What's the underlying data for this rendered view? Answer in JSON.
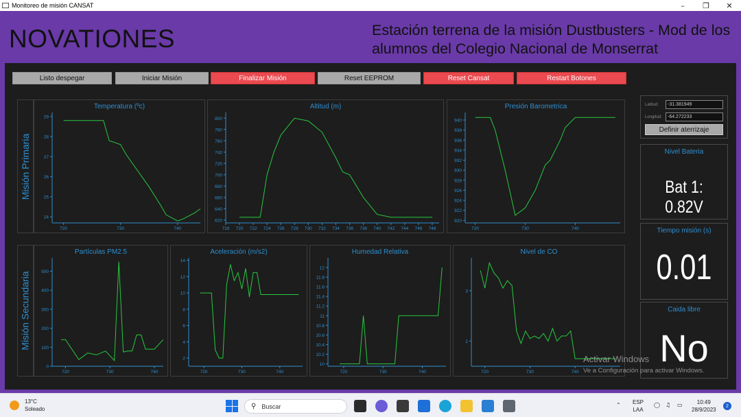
{
  "window": {
    "title": "Monitoreo de misión CANSAT"
  },
  "header": {
    "brand": "NOVATIONES",
    "mission_title": "Estación terrena de la misión Dustbusters - Mod de los alumnos del Colegio Nacional de Monserrat"
  },
  "toolbar": {
    "buttons": [
      {
        "label": "Listo despegar",
        "color": "#a9a9a9"
      },
      {
        "label": "Iniciar Misión",
        "color": "#a9a9a9"
      },
      {
        "label": "Finalizar Misión",
        "color": "#ea4a50"
      },
      {
        "label": "Reset EEPROM",
        "color": "#a9a9a9"
      },
      {
        "label": "Reset Cansat",
        "color": "#ea4a50"
      },
      {
        "label": "Restart Botones",
        "color": "#ea4a50"
      }
    ]
  },
  "sections": {
    "primary": "Misión Primaria",
    "secondary": "Misión Secundaria"
  },
  "landing": {
    "lat_label": "Latitud:",
    "lat_value": "-31.381949",
    "lon_label": "Longitud:",
    "lon_value": "-64.272233",
    "define_button": "Definir aterrizaje"
  },
  "battery": {
    "title": "Nivel Bateria",
    "value": "Bat 1: 0.82V"
  },
  "mission_time": {
    "title": "Tiempo misión (s)",
    "value": "0.01"
  },
  "free_fall": {
    "title": "Caida libre",
    "value": "No"
  },
  "watermark": {
    "line1": "Activar Windows",
    "line2": "Ve a Configuración para activar Windows."
  },
  "taskbar": {
    "weather_temp": "13°C",
    "weather_desc": "Soleado",
    "search_placeholder": "Buscar",
    "lang1": "ESP",
    "lang2": "LAA",
    "time": "10:49",
    "date": "28/9/2023",
    "notifications": "2"
  },
  "colors": {
    "accent_purple": "#6a3aa8",
    "line": "#27c93f",
    "axis": "#2e8fd0",
    "panel_bg": "#1d1d1d"
  },
  "chart_data": [
    {
      "id": "temperatura",
      "type": "line",
      "title": "Temperatura (ºc)",
      "xlim": [
        718,
        744
      ],
      "ylim": [
        23.7,
        29.2
      ],
      "xticks": [
        720,
        730,
        740
      ],
      "yticks": [
        24,
        25,
        26,
        27,
        28,
        29
      ],
      "x": [
        720,
        727,
        728,
        730,
        731,
        735,
        737,
        738,
        740,
        741,
        743,
        744
      ],
      "y": [
        28.8,
        28.8,
        27.8,
        27.6,
        27.1,
        25.5,
        24.6,
        24.1,
        23.8,
        23.9,
        24.2,
        24.4
      ]
    },
    {
      "id": "altitud",
      "type": "line",
      "title": "Altitud (m)",
      "xlim": [
        718,
        749
      ],
      "ylim": [
        615,
        810
      ],
      "xticks": [
        718,
        720,
        722,
        724,
        726,
        728,
        730,
        732,
        734,
        736,
        738,
        740,
        742,
        744,
        746,
        748
      ],
      "yticks": [
        620,
        640,
        660,
        680,
        700,
        720,
        740,
        760,
        780,
        800
      ],
      "x": [
        720,
        723,
        724,
        725,
        726,
        727,
        728,
        730,
        732,
        734,
        735,
        736,
        738,
        740,
        742,
        748
      ],
      "y": [
        625,
        625,
        700,
        740,
        770,
        785,
        800,
        795,
        775,
        730,
        705,
        700,
        660,
        630,
        625,
        625
      ]
    },
    {
      "id": "presion",
      "type": "line",
      "title": "Presión Barometrica",
      "xlim": [
        718,
        749
      ],
      "ylim": [
        919.5,
        941.5
      ],
      "xticks": [
        720,
        730,
        740
      ],
      "yticks": [
        920,
        922,
        924,
        926,
        928,
        930,
        932,
        934,
        936,
        938,
        940
      ],
      "x": [
        720,
        723,
        724,
        726,
        728,
        730,
        732,
        734,
        735,
        737,
        738,
        740,
        741,
        748
      ],
      "y": [
        940.5,
        940.5,
        938,
        930,
        921,
        922.5,
        926,
        931,
        932,
        936,
        938.5,
        940.5,
        940.5,
        940.5
      ]
    },
    {
      "id": "particulas",
      "type": "line",
      "title": "Partículas PM2.5",
      "xlim": [
        717,
        742
      ],
      "ylim": [
        0,
        570
      ],
      "xticks": [
        720,
        730,
        740
      ],
      "yticks": [
        0,
        100,
        200,
        300,
        400,
        500
      ],
      "x": [
        719,
        720,
        723,
        725,
        727,
        729,
        731,
        732,
        733,
        734,
        735,
        736,
        737,
        738,
        740,
        742
      ],
      "y": [
        140,
        140,
        35,
        70,
        60,
        80,
        30,
        550,
        75,
        80,
        80,
        165,
        165,
        90,
        90,
        140
      ]
    },
    {
      "id": "aceleracion",
      "type": "line",
      "title": "Aceleración (m/s2)",
      "xlim": [
        716,
        746
      ],
      "ylim": [
        1,
        14.3
      ],
      "xticks": [
        720,
        730,
        740
      ],
      "yticks": [
        2,
        4,
        6,
        8,
        10,
        12,
        14
      ],
      "x": [
        719,
        722,
        723,
        724,
        725,
        726,
        727,
        728,
        729,
        730,
        731,
        732,
        733,
        734,
        735,
        740,
        745
      ],
      "y": [
        10,
        10,
        3,
        2,
        2,
        11,
        13.5,
        11.5,
        12.5,
        10.5,
        13,
        9.5,
        12.5,
        12.5,
        9.8,
        9.8,
        9.8
      ]
    },
    {
      "id": "humedad",
      "type": "line",
      "title": "Humedad Relativa",
      "xlim": [
        716,
        746
      ],
      "ylim": [
        9.95,
        12.2
      ],
      "xticks": [
        720,
        730,
        740
      ],
      "yticks": [
        10,
        10.2,
        10.4,
        10.6,
        10.8,
        11,
        11.2,
        11.4,
        11.6,
        11.8,
        12
      ],
      "x": [
        719,
        724,
        725,
        726,
        733,
        734,
        744,
        745
      ],
      "y": [
        10,
        10,
        11,
        10,
        10,
        11,
        11,
        12
      ]
    },
    {
      "id": "co",
      "type": "line",
      "title": "Nivel de CO",
      "xlim": [
        717,
        750
      ],
      "ylim": [
        1.5,
        3.65
      ],
      "xticks": [
        720,
        730,
        740
      ],
      "yticks": [
        2,
        3
      ],
      "x": [
        719,
        720,
        721,
        722,
        723,
        724,
        725,
        726,
        727,
        728,
        729,
        730,
        731,
        732,
        733,
        734,
        735,
        736,
        737,
        738,
        739,
        740,
        741,
        742,
        743,
        744,
        745,
        746,
        747,
        748,
        749
      ],
      "y": [
        3.4,
        3.05,
        3.55,
        3.35,
        3.25,
        3.05,
        3.2,
        3.1,
        2.2,
        1.95,
        2.2,
        2.05,
        2.1,
        2.05,
        2.15,
        2.0,
        2.25,
        2.0,
        2.1,
        2.1,
        2.2,
        1.65,
        1.65,
        1.65,
        1.65,
        1.65,
        1.65,
        1.65,
        1.65,
        1.65,
        1.65
      ]
    }
  ]
}
